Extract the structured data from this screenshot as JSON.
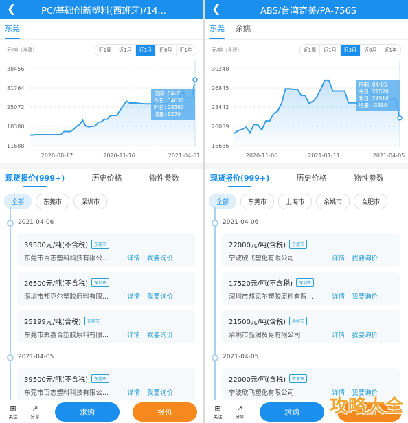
{
  "panels": [
    {
      "title": "PC/基础创新塑料(西班牙)/14...",
      "city_tabs": [
        "东莞"
      ],
      "unit": "元/吨（含税）",
      "ranges": [
        "近1周",
        "近1月",
        "近3月",
        "近6月",
        "近1年"
      ],
      "active_range": "近3月",
      "tooltip": {
        "date": "日期: 04-01",
        "today": "今日: 34630",
        "yesterday": "昨日: 28360",
        "change": "增量: 6270"
      },
      "section_tabs": [
        "现货报价(999+)",
        "历史价格",
        "物性参数"
      ],
      "chips": [
        "全部",
        "东莞市",
        "深圳市"
      ],
      "groups": [
        {
          "date": "2021-04-06",
          "items": [
            {
              "price": "39500元/吨(不含税)",
              "tag": "东莞市",
              "company": "东莞市百志塑料科技有限公...",
              "detail": "详情",
              "inquire": "我要询价"
            },
            {
              "price": "26500元/吨(不含税)",
              "tag": "深圳市",
              "company": "深圳市邦克尔塑胶原料有限...",
              "detail": "详情",
              "inquire": "我要询价"
            },
            {
              "price": "25199元/吨(含税)",
              "tag": "东莞市",
              "company": "东莞市聚鑫合塑胶原料有限...",
              "detail": "详情",
              "inquire": "我要询价"
            }
          ]
        },
        {
          "date": "2021-04-05",
          "items": [
            {
              "price": "39500元/吨(不含税)",
              "tag": "东莞市",
              "company": "东莞市百志塑料科技有限公...",
              "detail": "详情",
              "inquire": "我要询价"
            }
          ]
        }
      ],
      "bottom": {
        "follow": "关注",
        "share": "分享",
        "buy": "求购",
        "quote": "报价"
      }
    },
    {
      "title": "ABS/台湾奇美/PA-756S",
      "city_tabs": [
        "东莞",
        "余姚"
      ],
      "unit": "元/吨（含税）",
      "ranges": [
        "近1周",
        "近1月",
        "近3月",
        "近6月",
        "近1年"
      ],
      "active_range": "近3月",
      "tooltip": {
        "date": "日期: 04-05",
        "today": "今日: 21520",
        "yesterday": "昨日: 24910",
        "change": "增量: -3390"
      },
      "section_tabs": [
        "现货报价(999+)",
        "历史价格",
        "物性参数"
      ],
      "chips": [
        "全部",
        "东莞市",
        "上海市",
        "余姚市",
        "合肥市"
      ],
      "groups": [
        {
          "date": "2021-04-06",
          "items": [
            {
              "price": "22000元/吨(含税)",
              "tag": "宁波市",
              "company": "宁波欣飞塑化有限公司",
              "detail": "详情",
              "inquire": "我要询价"
            },
            {
              "price": "17520元/吨(不含税)",
              "tag": "深圳市",
              "company": "深圳市邦克尔塑胶原料有限...",
              "detail": "详情",
              "inquire": "我要询价"
            },
            {
              "price": "21500元/吨(含税)",
              "tag": "余姚市",
              "company": "余姚市晶润贸易有限公司",
              "detail": "详情",
              "inquire": "我要询价"
            }
          ]
        },
        {
          "date": "2021-04-05",
          "items": [
            {
              "price": "22000元/吨(含税)",
              "tag": "宁波市",
              "company": "宁波欣飞塑化有限公司",
              "detail": "详情",
              "inquire": "我要询价"
            }
          ]
        }
      ],
      "bottom": {
        "follow": "关注",
        "share": "分享",
        "buy": "求购",
        "quote": "报价"
      }
    }
  ],
  "watermark": "攻略大全",
  "colors": {
    "primary": "#1a8fee",
    "accent": "#f5891d",
    "tag": "#2a9fd4"
  },
  "chart_data": [
    {
      "type": "area",
      "title": "PC/基础创新塑料(西班牙)/14...",
      "ylabel": "元/吨（含税）",
      "yticks": [
        38456,
        31764,
        25072,
        18380,
        11688
      ],
      "ylim": [
        11688,
        38456
      ],
      "xticks": [
        "2020-08-17",
        "2020-11-16",
        "2021-04-01"
      ],
      "grid": true,
      "series": [
        {
          "name": "price",
          "values": [
            15400,
            15400,
            15500,
            15500,
            15500,
            15500,
            15500,
            15500,
            15500,
            15500,
            15500,
            16600,
            16600,
            16600,
            17200,
            18300,
            19000,
            20500,
            18500,
            18200,
            18400,
            18500,
            19800,
            20000,
            20800,
            20900,
            22200,
            22200,
            22200,
            24000,
            25500,
            27200,
            26500,
            26500,
            26500,
            26400,
            26300,
            26200,
            26200,
            26200,
            26500,
            27800,
            26500,
            26400,
            26200,
            28100,
            28200,
            28300,
            28400,
            30900,
            28360,
            28300,
            28400,
            34630
          ]
        }
      ]
    },
    {
      "type": "area",
      "title": "ABS/台湾奇美/PA-756S",
      "ylabel": "元/吨（含税）",
      "yticks": [
        30248,
        26845,
        23442,
        20039,
        16636
      ],
      "ylim": [
        16636,
        30248
      ],
      "xticks": [
        "2020-11-06",
        "2021-01-11",
        "2021-04-05"
      ],
      "grid": true,
      "series": [
        {
          "name": "price",
          "values": [
            18800,
            19300,
            19500,
            19900,
            18900,
            20400,
            20300,
            19400,
            21000,
            21000,
            22300,
            22700,
            24100,
            26700,
            26700,
            26600,
            26600,
            25500,
            25500,
            24100,
            24500,
            25300,
            26700,
            28200,
            28200,
            26300,
            26300,
            26300,
            26300,
            24200,
            24200,
            24200,
            24200,
            24200,
            26600,
            25600,
            25600,
            25500,
            25500,
            24910,
            24800,
            25000,
            21520
          ]
        }
      ]
    }
  ]
}
